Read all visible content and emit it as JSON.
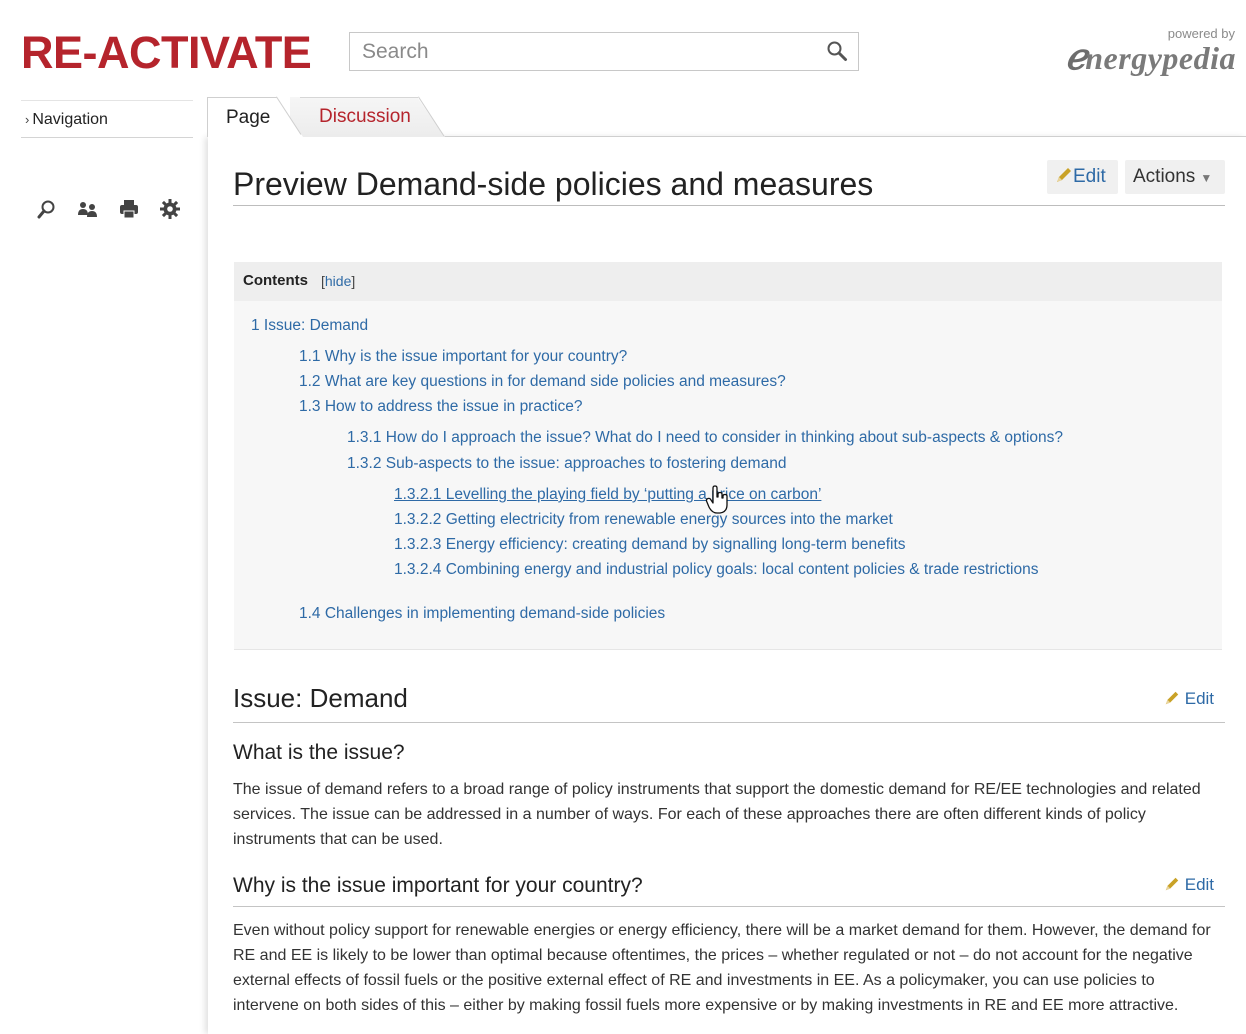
{
  "header": {
    "logo": "RE-ACTIVATE",
    "search_placeholder": "Search",
    "powered_by": "powered by",
    "brand": "nergypedia"
  },
  "sidebar": {
    "navigation_label": "Navigation",
    "tools": [
      "search-icon",
      "users-icon",
      "print-icon",
      "gear-icon"
    ]
  },
  "tabs": [
    {
      "label": "Page",
      "active": true
    },
    {
      "label": "Discussion",
      "active": false
    }
  ],
  "page": {
    "title": "Preview Demand-side policies and measures",
    "edit_label": "Edit",
    "actions_label": "Actions"
  },
  "toc": {
    "title": "Contents",
    "hide_label": "hide",
    "items": [
      {
        "text": "1 Issue: Demand",
        "level": 1
      },
      {
        "text": "1.1 Why is the issue important for your country?",
        "level": 2
      },
      {
        "text": "1.2 What are key questions in for demand side policies and measures?",
        "level": 2
      },
      {
        "text": "1.3 How to address the issue in practice?",
        "level": 2
      },
      {
        "text": "1.3.1 How do I approach the issue? What do I need to consider in thinking about sub-aspects & options?",
        "level": 3
      },
      {
        "text": "1.3.2 Sub-aspects to the issue: approaches to fostering demand",
        "level": 3
      },
      {
        "text": "1.3.2.1 Levelling the playing field by ‘putting a price on carbon’",
        "level": 4
      },
      {
        "text": "1.3.2.2 Getting electricity from renewable energy sources into the market",
        "level": 4
      },
      {
        "text": "1.3.2.3 Energy efficiency: creating demand by signalling long-term benefits",
        "level": 4
      },
      {
        "text": "1.3.2.4 Combining energy and industrial policy goals: local content policies & trade restrictions",
        "level": 4
      },
      {
        "text": "1.4 Challenges in implementing demand-side policies",
        "level": 2
      }
    ]
  },
  "sections": {
    "issue_heading": "Issue: Demand",
    "issue_edit": "Edit",
    "what_heading": "What is the issue?",
    "what_text": "The issue of demand refers to a broad range of policy instruments that support the domestic demand for RE/EE technologies and related services. The issue can be addressed in a number of ways. For each of these approaches there are often different kinds of policy instruments that can be used.",
    "why_heading": "Why is the issue important for your country?",
    "why_edit": "Edit",
    "why_text": "Even without policy support for renewable energies or energy efficiency, there will be a market demand for them. However, the demand for RE and EE is likely to be lower than optimal because oftentimes, the prices – whether regulated or not – do not account for the negative external effects of fossil fuels or the positive external effect of RE and investments in EE. As a policymaker, you can use policies to intervene on both sides of this – either by making fossil fuels more expensive or by making investments in RE and EE more attractive."
  }
}
